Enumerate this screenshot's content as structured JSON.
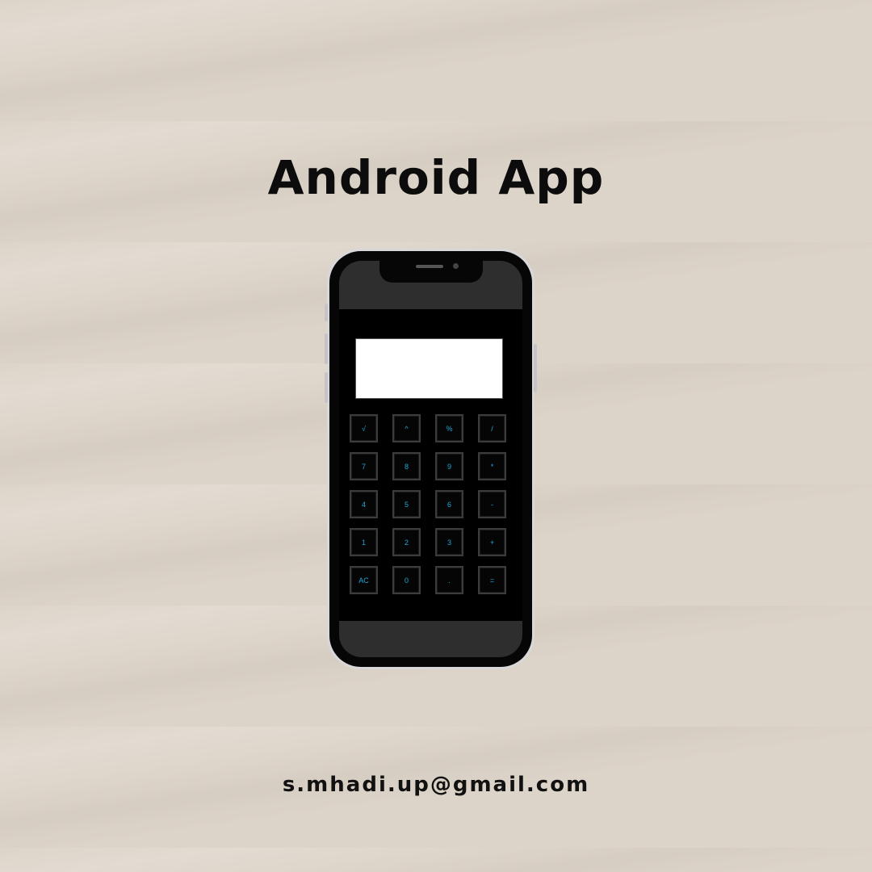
{
  "title": "Android App",
  "calculator": {
    "display_value": "",
    "keys": [
      "√",
      "^",
      "%",
      "/",
      "7",
      "8",
      "9",
      "*",
      "4",
      "5",
      "6",
      "-",
      "1",
      "2",
      "3",
      "+",
      "AC",
      "0",
      ".",
      "="
    ],
    "key_text_color": "#1fa8d8",
    "display_color": "#ffffff",
    "app_background": "#000000"
  },
  "email": "s.mhadi.up@gmail.com"
}
